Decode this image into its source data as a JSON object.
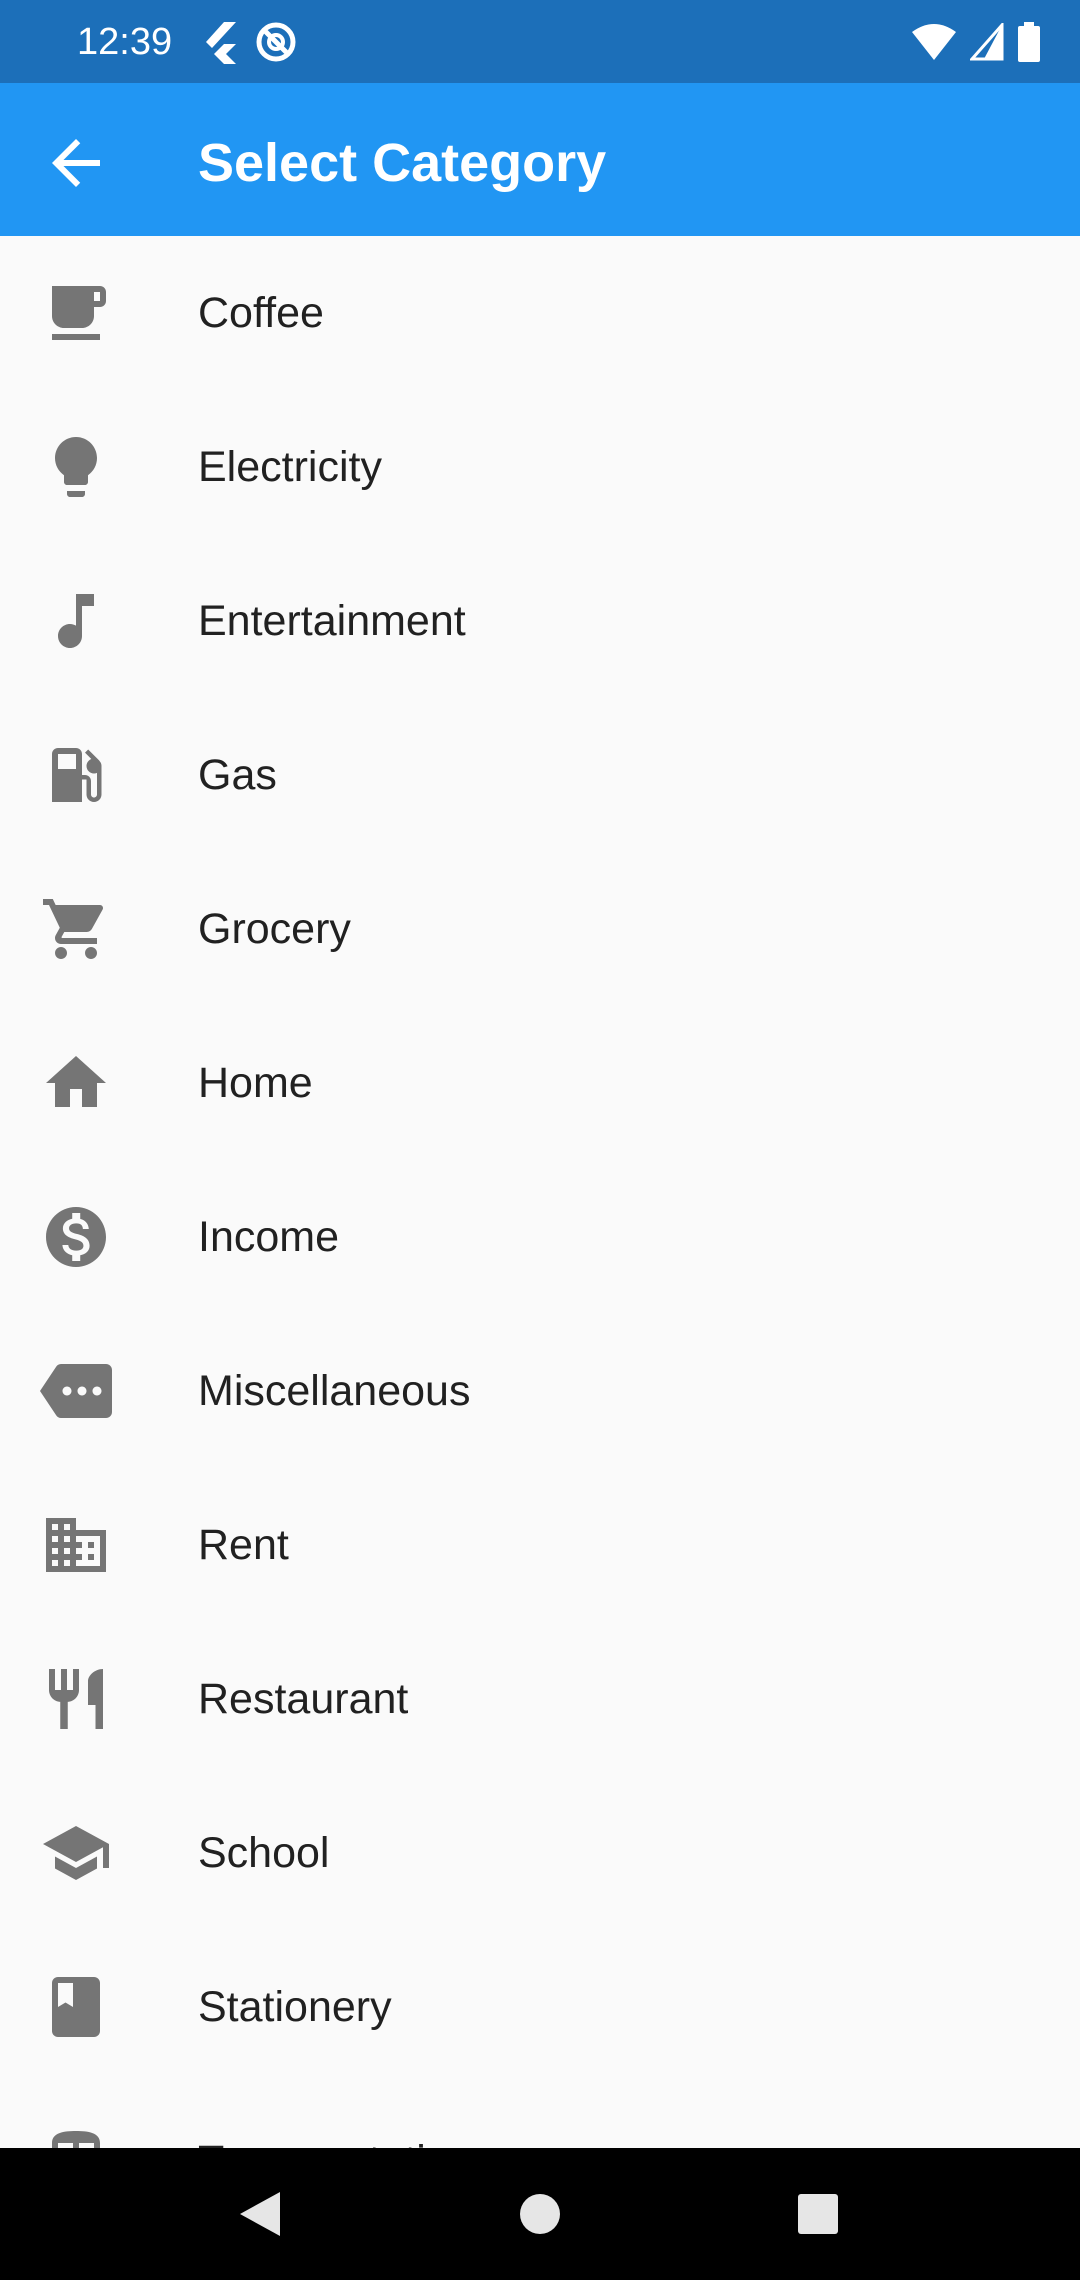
{
  "status_bar": {
    "time": "12:39"
  },
  "app_bar": {
    "title": "Select Category"
  },
  "categories": [
    {
      "label": "Coffee",
      "icon": "coffee-icon"
    },
    {
      "label": "Electricity",
      "icon": "lightbulb-icon"
    },
    {
      "label": "Entertainment",
      "icon": "music-note-icon"
    },
    {
      "label": "Gas",
      "icon": "gas-station-icon"
    },
    {
      "label": "Grocery",
      "icon": "shopping-cart-icon"
    },
    {
      "label": "Home",
      "icon": "home-icon"
    },
    {
      "label": "Income",
      "icon": "dollar-icon"
    },
    {
      "label": "Miscellaneous",
      "icon": "more-tag-icon"
    },
    {
      "label": "Rent",
      "icon": "building-icon"
    },
    {
      "label": "Restaurant",
      "icon": "restaurant-icon"
    },
    {
      "label": "School",
      "icon": "school-icon"
    },
    {
      "label": "Stationery",
      "icon": "book-icon"
    },
    {
      "label": "Transportation",
      "icon": "train-icon"
    }
  ],
  "colors": {
    "status_bar": "#1c6fb9",
    "app_bar": "#2196f3",
    "icon": "#757575",
    "background": "#fafafa"
  }
}
